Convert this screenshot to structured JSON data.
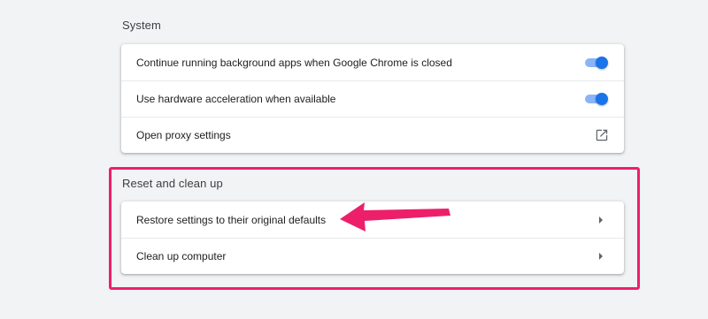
{
  "system_section": {
    "title": "System",
    "rows": [
      {
        "label": "Continue running background apps when Google Chrome is closed",
        "control": "toggle",
        "checked": true,
        "icon": "toggle-on"
      },
      {
        "label": "Use hardware acceleration when available",
        "control": "toggle",
        "checked": true,
        "icon": "toggle-on"
      },
      {
        "label": "Open proxy settings",
        "control": "external-link",
        "icon": "open-in-new-icon"
      }
    ]
  },
  "reset_section": {
    "title": "Reset and clean up",
    "rows": [
      {
        "label": "Restore settings to their original defaults",
        "control": "chevron",
        "icon": "chevron-right-icon"
      },
      {
        "label": "Clean up computer",
        "control": "chevron",
        "icon": "chevron-right-icon"
      }
    ]
  },
  "colors": {
    "page_background": "#f1f3f4",
    "toggle_accent": "#1a73e8",
    "annotation_highlight": "#ed1f6a"
  }
}
